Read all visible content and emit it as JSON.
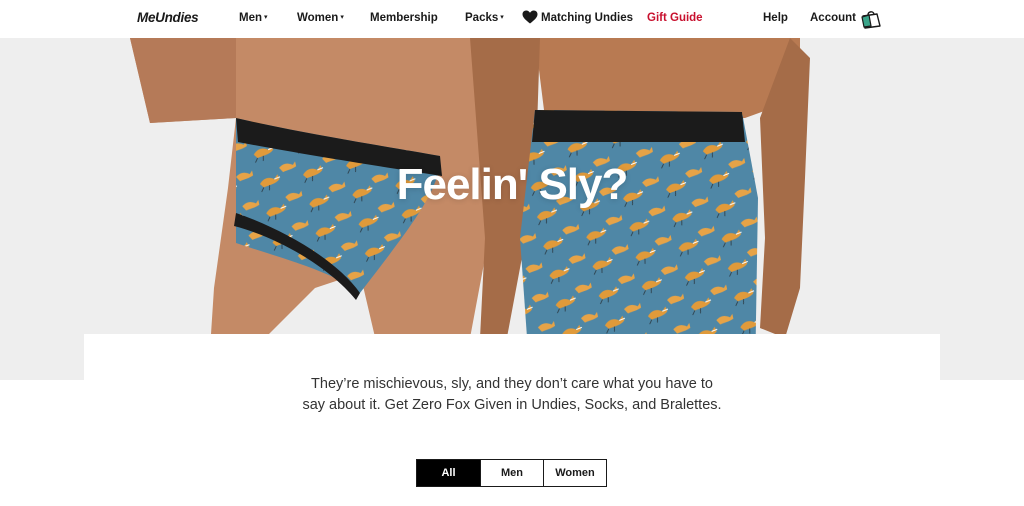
{
  "nav": {
    "logo": "MeUndies",
    "items": [
      {
        "label": "Men",
        "caret": "▾"
      },
      {
        "label": "Women",
        "caret": "▾"
      },
      {
        "label": "Membership"
      },
      {
        "label": "Packs",
        "caret": "▾"
      },
      {
        "label": "Matching Undies",
        "icon": "heart-icon"
      },
      {
        "label": "Gift Guide",
        "color": "#c8102e"
      }
    ],
    "help": "Help",
    "account": "Account",
    "cart_icon": "shopping-bag-icon"
  },
  "hero": {
    "title": "Feelin' Sly?",
    "print_color": "#4f87a6",
    "fox_color": "#e09a3a",
    "waistband_color": "#1b1b1b"
  },
  "content": {
    "description": "They’re mischievous, sly, and they don’t care what you have to say about it. Get Zero Fox Given in Undies, Socks, and Bralettes."
  },
  "filters": {
    "tabs": [
      {
        "label": "All",
        "active": true
      },
      {
        "label": "Men",
        "active": false
      },
      {
        "label": "Women",
        "active": false
      }
    ]
  }
}
